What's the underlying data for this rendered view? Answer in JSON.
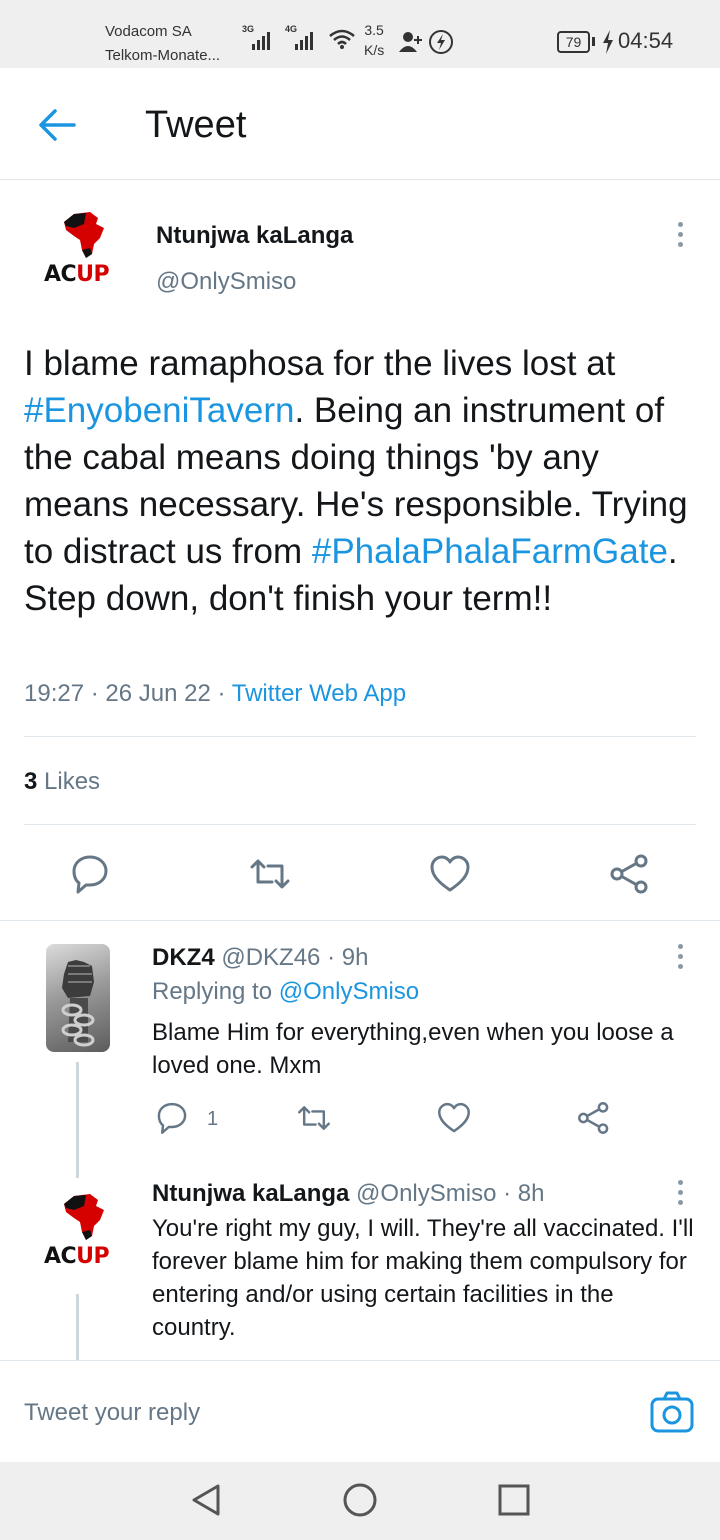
{
  "status_bar": {
    "carrier_1": "Vodacom SA",
    "carrier_2": "Telkom-Monate...",
    "sim1_type": "3G",
    "sim2_type": "4G",
    "speed_value": "3.5",
    "speed_unit": "K/s",
    "battery": "79",
    "time": "04:54"
  },
  "header": {
    "title": "Tweet"
  },
  "tweet": {
    "avatar_text_black": "AC",
    "avatar_text_red": "UP",
    "author_name": "Ntunjwa kaLanga",
    "author_handle": "@OnlySmiso",
    "text_1": "I blame ramaphosa for the lives lost at ",
    "hashtag_1": "#EnyobeniTavern",
    "text_2": ". Being an instrument of the cabal means doing things 'by any means necessary. He's responsible. Trying to distract us from ",
    "hashtag_2": "#PhalaPhalaFarmGate",
    "text_3": ". Step down, don't finish your term!!",
    "time": "19:27",
    "date": "26 Jun 22",
    "source": "Twitter Web App",
    "likes_count": "3",
    "likes_label": "Likes"
  },
  "replies": [
    {
      "name": "DKZ4",
      "handle": "@DKZ46",
      "age": "9h",
      "replying_prefix": "Replying to",
      "replying_to": "@OnlySmiso",
      "text": "Blame Him for everything,even when you loose a loved one. Mxm",
      "reply_count": "1"
    },
    {
      "name": "Ntunjwa kaLanga",
      "handle": "@OnlySmiso",
      "age": "8h",
      "avatar_text_black": "AC",
      "avatar_text_red": "UP",
      "text": "You're right my guy, I will. They're all vaccinated. I'll forever blame him for making them compulsory for entering and/or using certain facilities in the country."
    }
  ],
  "compose": {
    "placeholder": "Tweet your reply"
  },
  "icons": {
    "back": "arrow-left-icon",
    "more": "more-vertical-icon",
    "reply": "speech-bubble-icon",
    "retweet": "retweet-icon",
    "like": "heart-icon",
    "share": "share-icon",
    "camera": "camera-icon"
  },
  "colors": {
    "accent": "#1b95e0",
    "text": "#14171a",
    "secondary": "#657786",
    "icon": "#657786"
  }
}
